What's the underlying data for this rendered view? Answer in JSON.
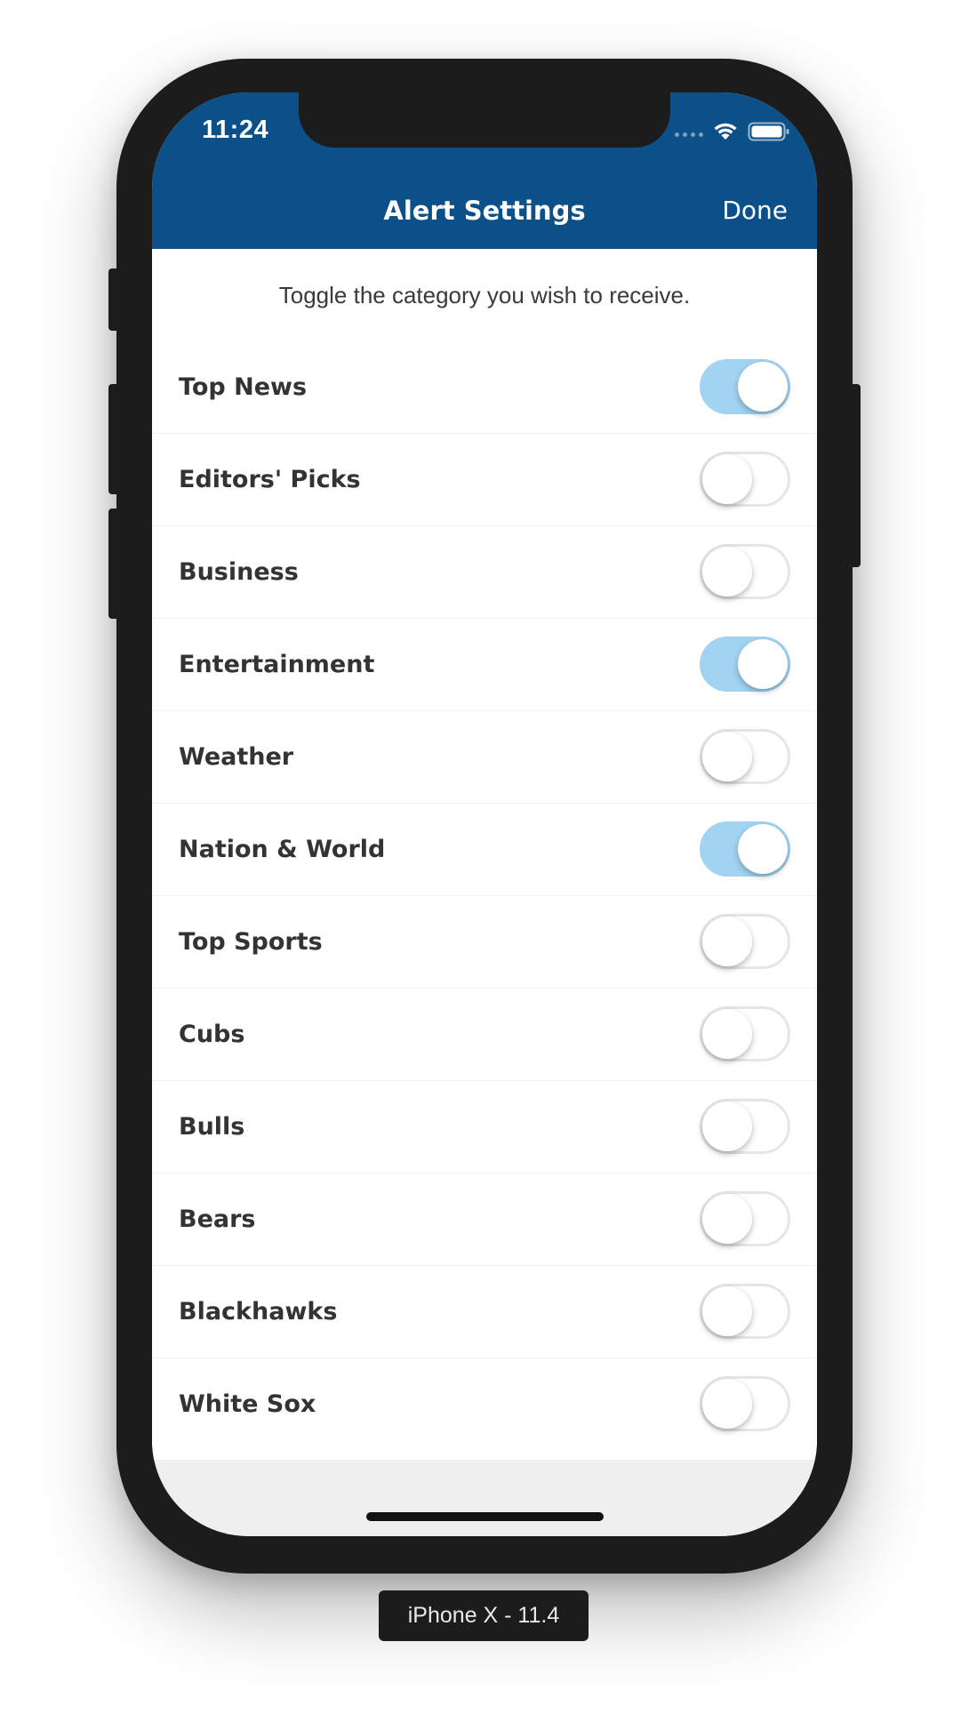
{
  "status_bar": {
    "time": "11:24",
    "icons": [
      "signal-dots-icon",
      "wifi-icon",
      "battery-icon"
    ]
  },
  "nav": {
    "title": "Alert Settings",
    "done_label": "Done"
  },
  "instructions": "Toggle the category you wish to receive.",
  "categories": [
    {
      "label": "Top News",
      "enabled": true
    },
    {
      "label": "Editors' Picks",
      "enabled": false
    },
    {
      "label": "Business",
      "enabled": false
    },
    {
      "label": "Entertainment",
      "enabled": true
    },
    {
      "label": "Weather",
      "enabled": false
    },
    {
      "label": "Nation & World",
      "enabled": true
    },
    {
      "label": "Top Sports",
      "enabled": false
    },
    {
      "label": "Cubs",
      "enabled": false
    },
    {
      "label": "Bulls",
      "enabled": false
    },
    {
      "label": "Bears",
      "enabled": false
    },
    {
      "label": "Blackhawks",
      "enabled": false
    },
    {
      "label": "White Sox",
      "enabled": false
    }
  ],
  "device_label": "iPhone X - 11.4",
  "colors": {
    "header": "#0b5088",
    "toggle_on": "#a2d3f2",
    "toggle_off_border": "#e6e6e6",
    "text": "#333333"
  }
}
